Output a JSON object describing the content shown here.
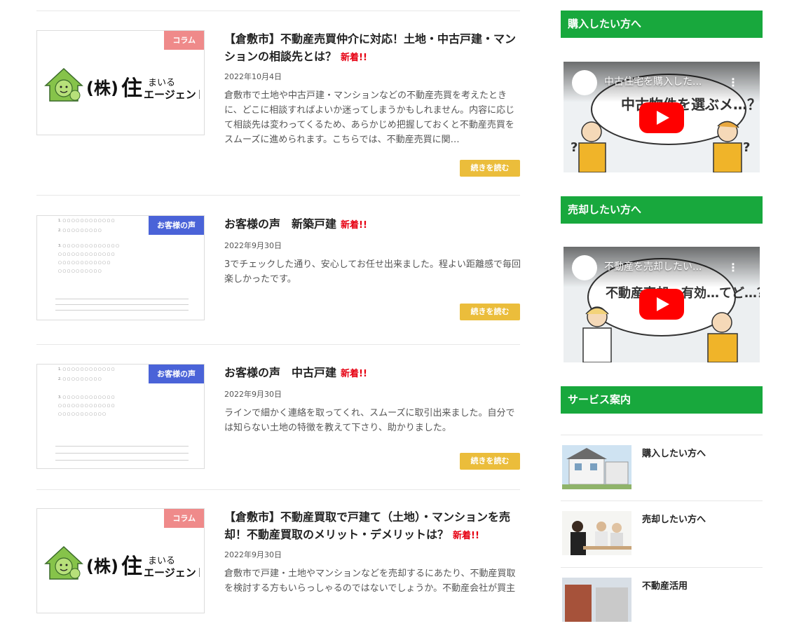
{
  "posts": [
    {
      "category": "コラム",
      "title": "【倉敷市】不動産売買仲介に対応！土地・中古戸建・マンションの相談先とは？",
      "new_label": "新着!!",
      "date": "2022年10月4日",
      "excerpt": "倉敷市で土地や中古戸建・マンションなどの不動産売買を考えたときに、どこに相談すればよいか迷ってしまうかもしれません。内容に応じて相談先は変わってくるため、あらかじめ把握しておくと不動産売買をスムーズに進められます。こちらでは、不動産売買に関…",
      "more": "続きを読む"
    },
    {
      "category": "お客様の声",
      "title": "お客様の声　新築戸建",
      "new_label": "新着!!",
      "date": "2022年9月30日",
      "excerpt": "3でチェックした通り、安心してお任せ出来ました。程よい距離感で毎回楽しかったです。",
      "more": "続きを読む"
    },
    {
      "category": "お客様の声",
      "title": "お客様の声　中古戸建",
      "new_label": "新着!!",
      "date": "2022年9月30日",
      "excerpt": "ラインで細かく連絡を取ってくれ、スムーズに取引出来ました。自分では知らない土地の特徴を教えて下さり、助かりました。",
      "more": "続きを読む"
    },
    {
      "category": "コラム",
      "title": "【倉敷市】不動産買取で戸建て（土地）・マンションを売却！不動産買取のメリット・デメリットは？",
      "new_label": "新着!!",
      "date": "2022年9月30日",
      "excerpt": "倉敷市で戸建・土地やマンションなどを売却するにあたり、不動産買取を検討する方もいらっしゃるのではないでしょうか。不動産会社が買主"
    }
  ],
  "logo": {
    "kabu": "(株)",
    "su": "住",
    "line1": "まいる",
    "line2": "エージェント"
  },
  "sidebar": {
    "buy_heading": "購入したい方へ",
    "buy_video_title": "中古住宅を購入した...",
    "buy_video_caption": "中古物件を選ぶメ…？",
    "sell_heading": "売却したい方へ",
    "sell_video_title": "不動産を売却したい...",
    "sell_video_caption": "不動産売却・有効…てど…？",
    "service_heading": "サービス案内",
    "services": [
      "購入したい方へ",
      "売却したい方へ",
      "不動産活用"
    ]
  },
  "colors": {
    "brand_green": "#18a83d",
    "button_yellow": "#ebbd3b",
    "column_pink": "#ef8a8a",
    "voice_blue": "#4a63d8",
    "new_red": "#e60012"
  }
}
